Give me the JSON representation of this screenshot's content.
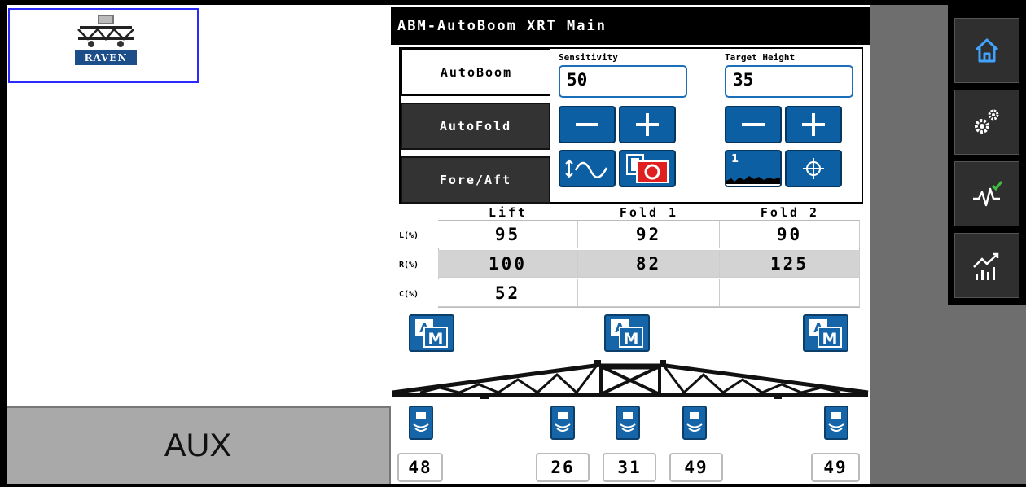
{
  "logo": {
    "brand_text": "RAVEN"
  },
  "aux": {
    "label": "AUX"
  },
  "header": {
    "title": "ABM-AutoBoom XRT Main"
  },
  "tabs": [
    {
      "label": "AutoBoom",
      "active": true
    },
    {
      "label": "AutoFold",
      "active": false
    },
    {
      "label": "Fore/Aft",
      "active": false
    }
  ],
  "sensitivity": {
    "label": "Sensitivity",
    "value": "50"
  },
  "target_height": {
    "label": "Target Height",
    "value": "35"
  },
  "table": {
    "columns": [
      "Lift",
      "Fold 1",
      "Fold 2"
    ],
    "rows": [
      {
        "label": "L(%)",
        "values": [
          "95",
          "92",
          "90"
        ]
      },
      {
        "label": "R(%)",
        "values": [
          "100",
          "82",
          "125"
        ]
      },
      {
        "label": "C(%)",
        "values": [
          "52",
          "",
          ""
        ]
      }
    ]
  },
  "profile_number": "1",
  "sensor_readouts": [
    "48",
    "26",
    "31",
    "49",
    "49"
  ],
  "sidebar": [
    "home-icon",
    "settings-gears-icon",
    "diagnostics-icon",
    "performance-chart-icon"
  ],
  "colors": {
    "accent_blue": "#1565a8",
    "title_bar": "#000000",
    "aux_bg": "#a9a9a9",
    "stop_red": "#e02020",
    "check_green": "#3fbf3f"
  }
}
